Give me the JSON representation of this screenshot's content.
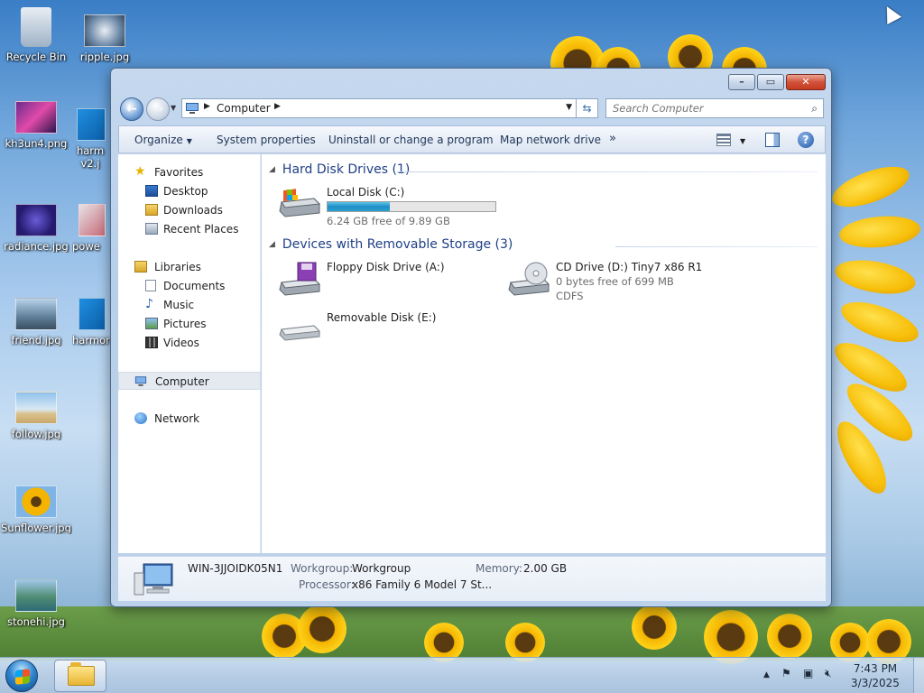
{
  "desktop": {
    "icons": [
      {
        "label": "Recycle Bin"
      },
      {
        "label": "ripple.jpg"
      },
      {
        "label": "kh3un4.png"
      },
      {
        "label": "harm v2.j"
      },
      {
        "label": "radiance.jpg"
      },
      {
        "label": "powe"
      },
      {
        "label": "friend.jpg"
      },
      {
        "label": "harmor"
      },
      {
        "label": "follow.jpg"
      },
      {
        "label": "Sunflower.jpg"
      },
      {
        "label": "stonehi.jpg"
      }
    ]
  },
  "window": {
    "address": {
      "crumb": "Computer",
      "search_placeholder": "Search Computer"
    },
    "toolbar": {
      "organize": "Organize",
      "system_properties": "System properties",
      "uninstall": "Uninstall or change a program",
      "map_drive": "Map network drive",
      "more": "»"
    },
    "nav": {
      "favorites": "Favorites",
      "desktop": "Desktop",
      "downloads": "Downloads",
      "recent": "Recent Places",
      "libraries": "Libraries",
      "documents": "Documents",
      "music": "Music",
      "pictures": "Pictures",
      "videos": "Videos",
      "computer": "Computer",
      "network": "Network"
    },
    "groups": {
      "hdd": {
        "title": "Hard Disk Drives (1)",
        "drives": [
          {
            "name": "Local Disk (C:)",
            "free": "6.24 GB free of 9.89 GB",
            "used_fraction": 0.37
          }
        ]
      },
      "removable": {
        "title": "Devices with Removable Storage (3)",
        "drives": [
          {
            "name": "Floppy Disk Drive (A:)"
          },
          {
            "name": "CD Drive (D:) Tiny7 x86 R1",
            "free": "0 bytes free of 699 MB",
            "fs": "CDFS"
          },
          {
            "name": "Removable Disk (E:)"
          }
        ]
      }
    },
    "details": {
      "computer_name": "WIN-3JJOIDK05N1",
      "workgroup_label": "Workgroup:",
      "workgroup": "Workgroup",
      "memory_label": "Memory:",
      "memory": "2.00 GB",
      "processor_label": "Processor:",
      "processor": "x86 Family 6 Model 7 St..."
    }
  },
  "taskbar": {
    "time": "7:43 PM",
    "date": "3/3/2025"
  }
}
